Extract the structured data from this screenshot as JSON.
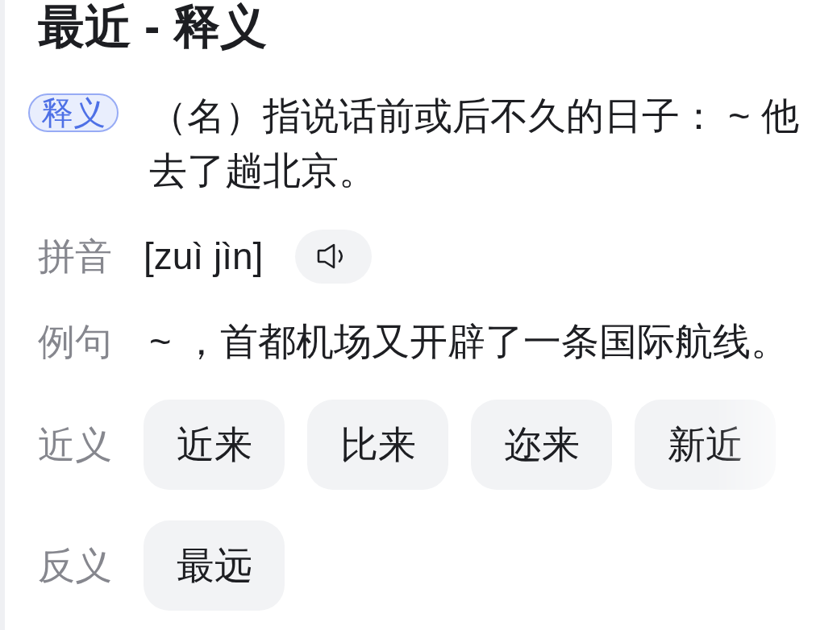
{
  "title": "最近 - 释义",
  "definition": {
    "badge": "释义",
    "text": "（名）指说话前或后不久的日子： ~ 他去了趟北京。"
  },
  "pinyin": {
    "label": "拼音",
    "reading": "[zuì jìn]"
  },
  "example": {
    "label": "例句",
    "text": "~ ，首都机场又开辟了一条国际航线。"
  },
  "synonyms": {
    "label": "近义",
    "words": [
      "近来",
      "比来",
      "迩来",
      "新近"
    ]
  },
  "antonyms": {
    "label": "反义",
    "words": [
      "最远"
    ]
  }
}
